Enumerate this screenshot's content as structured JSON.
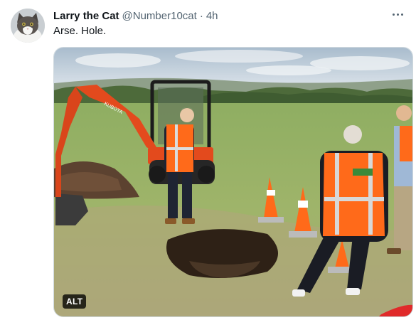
{
  "tweet": {
    "display_name": "Larry the Cat",
    "handle": "@Number10cat",
    "separator": "·",
    "time": "4h",
    "text": "Arse. Hole.",
    "more_icon": "ellipsis-icon",
    "media": {
      "alt_badge": "ALT",
      "excavator_brand": "KUBOTA"
    }
  },
  "colors": {
    "name": "#0f1419",
    "secondary": "#536471",
    "excavator_orange": "#e34a1d",
    "vest_orange": "#ff6a1a"
  }
}
